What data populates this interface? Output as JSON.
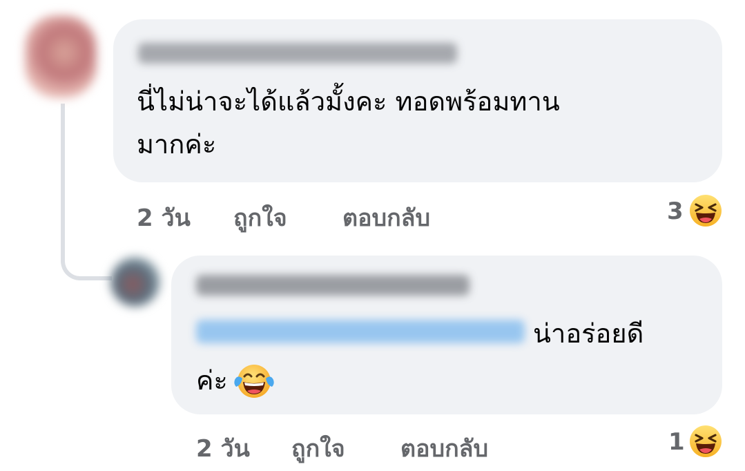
{
  "comment": {
    "author": "",
    "text": "นี่ไม่น่าจะได้แล้วมั้งคะ ทอดพร้อมทาน\nมากค่ะ",
    "line1": "นี่ไม่น่าจะได้แล้วมั้งคะ ทอดพร้อมทาน",
    "line2": "มากค่ะ",
    "time": "2 วัน",
    "like_label": "ถูกใจ",
    "reply_label": "ตอบกลับ",
    "reaction_count": "3",
    "reaction_icon": "haha-emoji-icon"
  },
  "reply": {
    "author": "",
    "mention": "",
    "text_after_mention": "น่าอร่อยดี",
    "line2": "ค่ะ",
    "inline_emoji": "face-with-tears-of-joy-icon",
    "time": "2 วัน",
    "like_label": "ถูกใจ",
    "reply_label": "ตอบกลับ",
    "reaction_count": "1",
    "reaction_icon": "haha-emoji-icon"
  },
  "colors": {
    "bubble": "#f0f2f5",
    "meta_text": "#65676b",
    "thread_line": "#dcdfe4",
    "mention": "#1877f2"
  }
}
